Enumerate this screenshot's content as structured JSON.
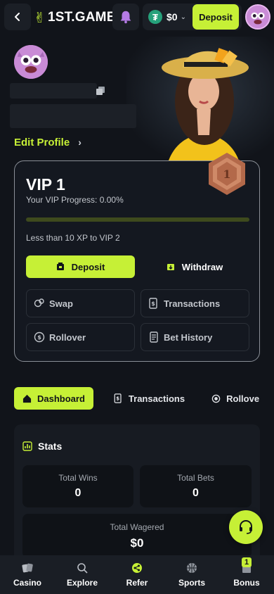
{
  "header": {
    "logo_text": "1ST.GAME",
    "balance": "$0",
    "currency_symbol": "₮",
    "deposit_label": "Deposit"
  },
  "profile": {
    "edit_label": "Edit Profile"
  },
  "vip": {
    "title": "VIP 1",
    "progress_text": "Your VIP Progress: 0.00%",
    "progress_fraction": 0.0,
    "next_level_text": "Less than 10 XP to VIP 2",
    "badge_level": "1",
    "deposit_label": "Deposit",
    "withdraw_label": "Withdraw",
    "actions": [
      {
        "label": "Swap"
      },
      {
        "label": "Transactions"
      },
      {
        "label": "Rollover"
      },
      {
        "label": "Bet History"
      }
    ]
  },
  "tabs": [
    {
      "label": "Dashboard",
      "active": true
    },
    {
      "label": "Transactions",
      "active": false
    },
    {
      "label": "Rollove",
      "active": false
    }
  ],
  "stats": {
    "title": "Stats",
    "total_wins_label": "Total Wins",
    "total_wins_value": "0",
    "total_bets_label": "Total Bets",
    "total_bets_value": "0",
    "total_wagered_label": "Total Wagered",
    "total_wagered_value": "$0"
  },
  "bottom_nav": [
    {
      "label": "Casino",
      "icon": "cards-icon"
    },
    {
      "label": "Explore",
      "icon": "explore-icon"
    },
    {
      "label": "Refer",
      "icon": "share-icon"
    },
    {
      "label": "Sports",
      "icon": "basketball-icon"
    },
    {
      "label": "Bonus",
      "icon": "gift-icon",
      "badge": "1"
    }
  ],
  "colors": {
    "accent": "#c6f036",
    "background": "#11141a",
    "card": "#141820",
    "tether": "#26a17b"
  }
}
